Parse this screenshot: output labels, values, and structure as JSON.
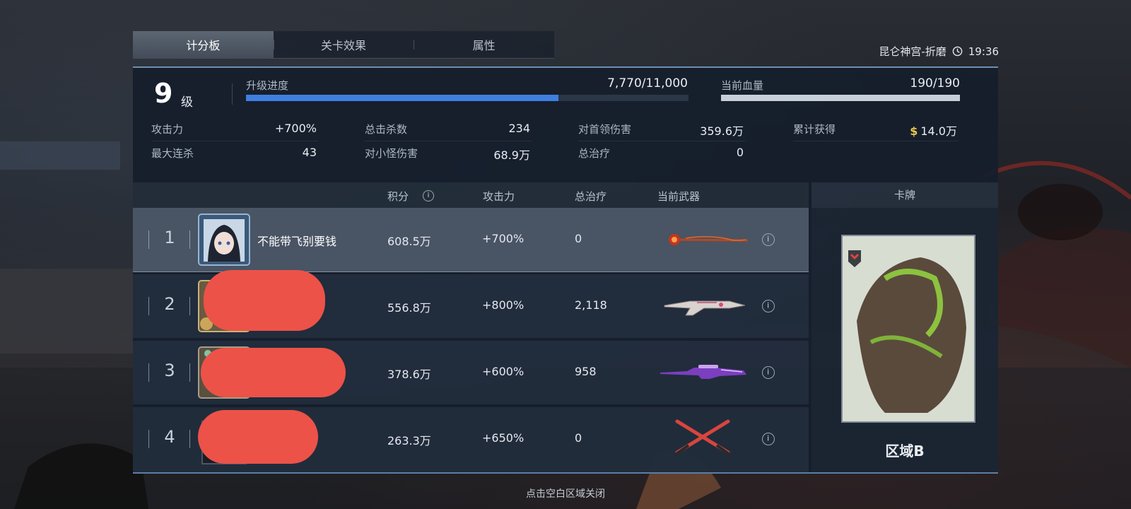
{
  "tabs": [
    {
      "label": "计分板",
      "active": true
    },
    {
      "label": "关卡效果",
      "active": false
    },
    {
      "label": "属性",
      "active": false
    }
  ],
  "map": {
    "name": "昆仑神宫-折磨",
    "time": "19:36"
  },
  "level": {
    "number": "9",
    "unit": "级"
  },
  "upgrade": {
    "label": "升级进度",
    "value": "7,770/11,000",
    "progress": 0.706
  },
  "health": {
    "label": "当前血量",
    "value": "190/190",
    "progress": 1.0
  },
  "stats": {
    "attack": {
      "label": "攻击力",
      "value": "+700%"
    },
    "max_combo": {
      "label": "最大连杀",
      "value": "43"
    },
    "total_kills": {
      "label": "总击杀数",
      "value": "234"
    },
    "minion_damage": {
      "label": "对小怪伤害",
      "value": "68.9万"
    },
    "boss_damage": {
      "label": "对首领伤害",
      "value": "359.6万"
    },
    "total_heal": {
      "label": "总治疗",
      "value": "0"
    },
    "earned": {
      "label": "累计获得",
      "currency": "$",
      "value": "14.0万"
    }
  },
  "table": {
    "headers": {
      "score": "积分",
      "attack": "攻击力",
      "heal": "总治疗",
      "weapon": "当前武器"
    },
    "rows": [
      {
        "rank": "1",
        "name": "不能带飞别要钱",
        "score": "608.5万",
        "attack": "+700%",
        "heal": "0",
        "weapon_icon": "flame-staff-icon"
      },
      {
        "rank": "2",
        "name": "",
        "score": "556.8万",
        "attack": "+800%",
        "heal": "2,118",
        "weapon_icon": "white-rifle-icon"
      },
      {
        "rank": "3",
        "name": "",
        "score": "378.6万",
        "attack": "+600%",
        "heal": "958",
        "weapon_icon": "purple-sniper-icon"
      },
      {
        "rank": "4",
        "name": "",
        "score": "263.3万",
        "attack": "+650%",
        "heal": "0",
        "weapon_icon": "crossed-blades-icon"
      }
    ]
  },
  "card": {
    "header": "卡牌",
    "name": "区域B"
  },
  "hint": "点击空白区域关闭",
  "colors": {
    "progress_fill": "#3f7fe0",
    "health_fill": "#c7d0d8",
    "redaction": "#ec5248",
    "accent_line": "#6d8fb0",
    "currency": "#e9c44a"
  }
}
